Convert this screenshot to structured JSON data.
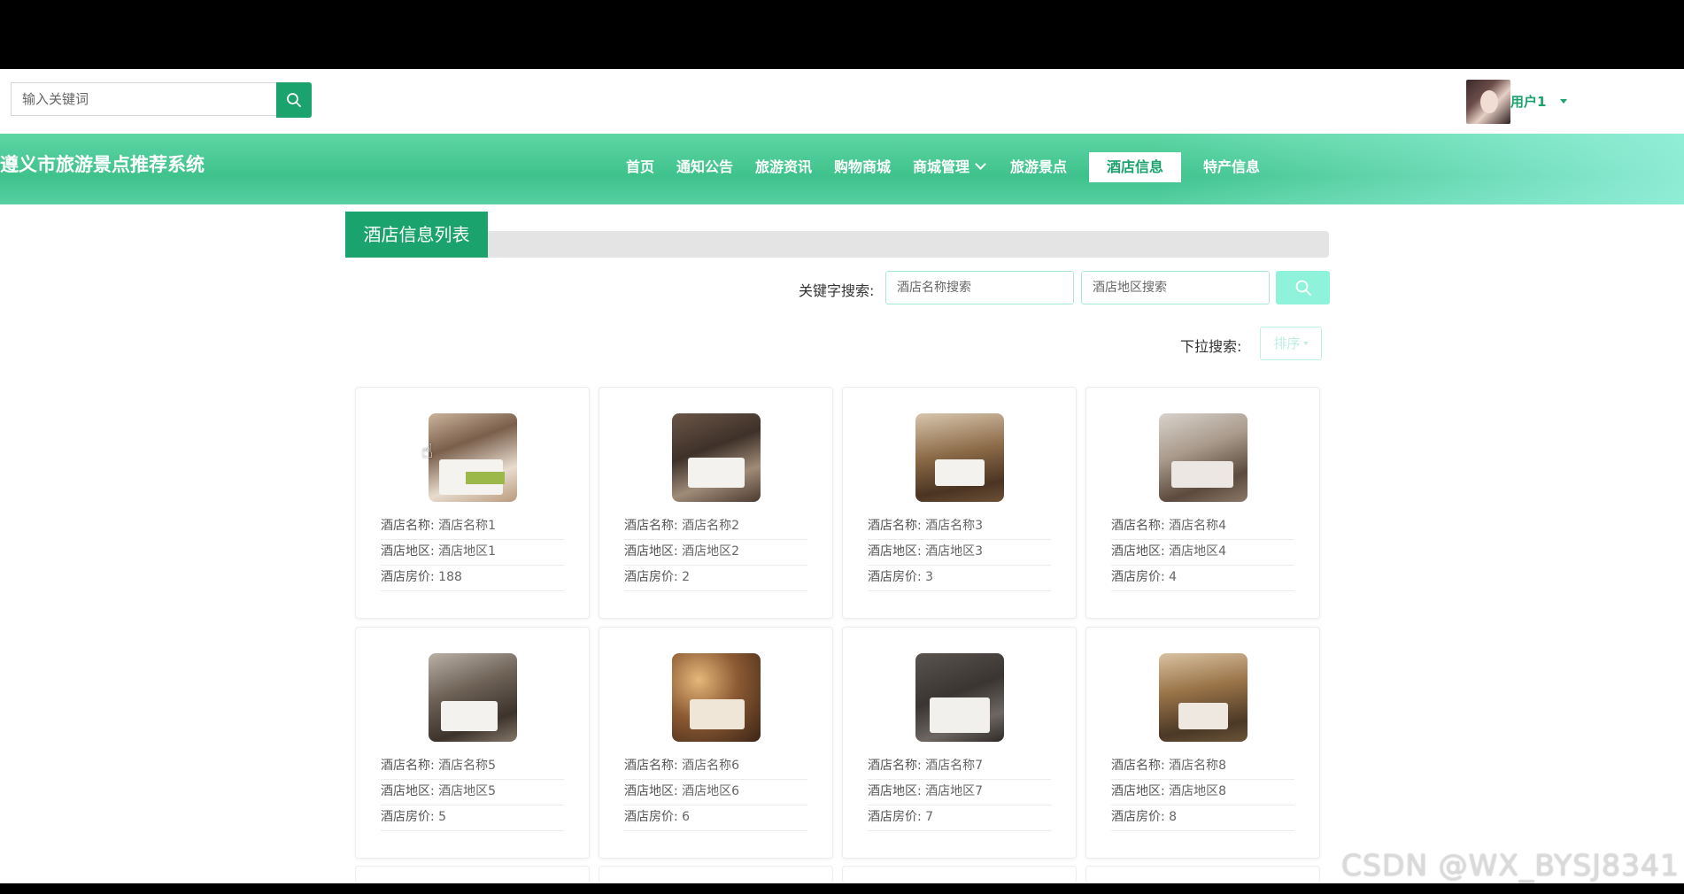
{
  "header": {
    "search_placeholder": "输入关键词",
    "username": "用户1"
  },
  "site": {
    "title": "遵义市旅游景点推荐系统"
  },
  "nav": {
    "items": [
      "首页",
      "通知公告",
      "旅游资讯",
      "购物商城",
      "商城管理",
      "旅游景点",
      "酒店信息",
      "特产信息"
    ],
    "active": "酒店信息"
  },
  "section": {
    "title": "酒店信息列表"
  },
  "filters": {
    "keyword_label": "关键字搜索:",
    "name_placeholder": "酒店名称搜索",
    "area_placeholder": "酒店地区搜索",
    "dropdown_label": "下拉搜索:",
    "sort_label": "排序"
  },
  "labels": {
    "name": "酒店名称:",
    "area": "酒店地区:",
    "price": "酒店房价:"
  },
  "hotels": [
    {
      "name": "酒店名称1",
      "area": "酒店地区1",
      "price": "188"
    },
    {
      "name": "酒店名称2",
      "area": "酒店地区2",
      "price": "2"
    },
    {
      "name": "酒店名称3",
      "area": "酒店地区3",
      "price": "3"
    },
    {
      "name": "酒店名称4",
      "area": "酒店地区4",
      "price": "4"
    },
    {
      "name": "酒店名称5",
      "area": "酒店地区5",
      "price": "5"
    },
    {
      "name": "酒店名称6",
      "area": "酒店地区6",
      "price": "6"
    },
    {
      "name": "酒店名称7",
      "area": "酒店地区7",
      "price": "7"
    },
    {
      "name": "酒店名称8",
      "area": "酒店地区8",
      "price": "8"
    }
  ],
  "watermark": "CSDN @WX_BYSJ8341",
  "colors": {
    "brand": "#1aa36c",
    "nav_start": "#3fc28c",
    "nav_end": "#96f0dc",
    "search_button": "#8ff3dc"
  }
}
